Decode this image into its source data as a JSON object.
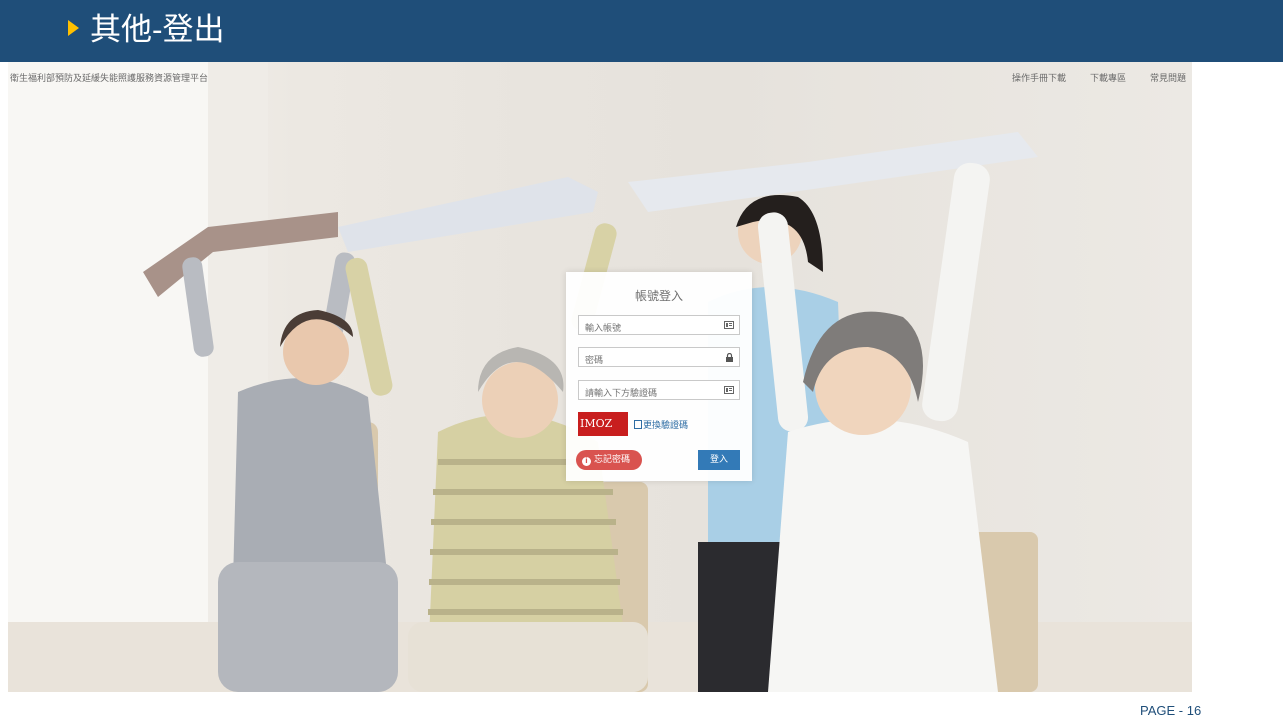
{
  "slide": {
    "title": "其他-登出",
    "page_label": "PAGE  -  16"
  },
  "site": {
    "name": "衛生福利部預防及延緩失能照護服務資源管理平台",
    "links": [
      "操作手冊下載",
      "下載專區",
      "常見問題"
    ]
  },
  "login": {
    "title": "帳號登入",
    "account_placeholder": "輸入帳號",
    "password_placeholder": "密碼",
    "captcha_placeholder": "請輸入下方驗證碼",
    "captcha_text": "IMOZ",
    "refresh_label": "更換驗證碼",
    "forgot_label": "忘記密碼",
    "login_label": "登入"
  },
  "colors": {
    "title_bar": "#1f4e79",
    "accent_arrow": "#ffc000",
    "forgot_button": "#d9534f",
    "login_button": "#337ab7"
  },
  "icons": {
    "account_field": "id-card-icon",
    "password_field": "lock-icon",
    "captcha_field": "id-card-icon",
    "forgot_button": "info-icon"
  }
}
